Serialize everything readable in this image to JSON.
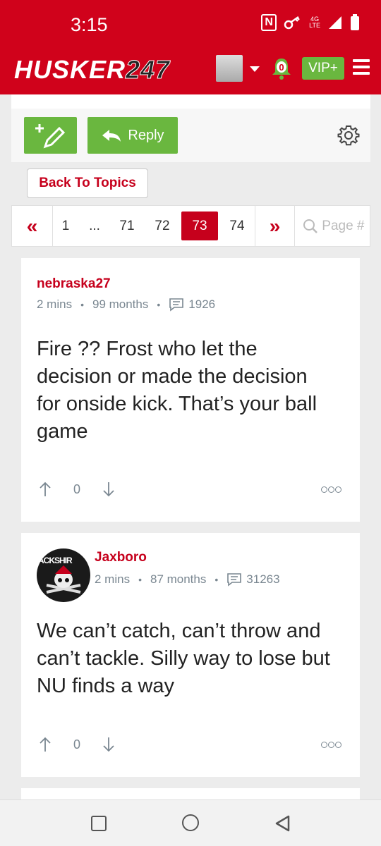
{
  "status_bar": {
    "time": "3:15",
    "network": "4G LTE"
  },
  "header": {
    "logo_text": "HUSKER",
    "logo_number": "247",
    "notification_count": "0",
    "vip_label": "VIP+"
  },
  "toolbar": {
    "reply_label": "Reply"
  },
  "back_to_topics": "Back To Topics",
  "pagination": {
    "prev_symbol": "«",
    "next_symbol": "»",
    "pages": [
      "1",
      "...",
      "71",
      "72",
      "73",
      "74"
    ],
    "current": "73",
    "search_placeholder": "Page #"
  },
  "posts": [
    {
      "author": "nebraska27",
      "time_ago": "2 mins",
      "member_age": "99 months",
      "post_count": "1926",
      "text": "Fire ?? Frost who let the decision or made the decision for onside kick. That’s your ball game",
      "votes": "0"
    },
    {
      "author": "Jaxboro",
      "avatar_text": "ACKSHIR",
      "time_ago": "2 mins",
      "member_age": "87 months",
      "post_count": "31263",
      "text": "We can’t catch, can’t throw and can’t tackle. Silly way to lose but NU finds a way",
      "votes": "0"
    }
  ],
  "colors": {
    "brand_red": "#d0021b",
    "accent_green": "#6ab73f",
    "link_red": "#c6001c"
  }
}
